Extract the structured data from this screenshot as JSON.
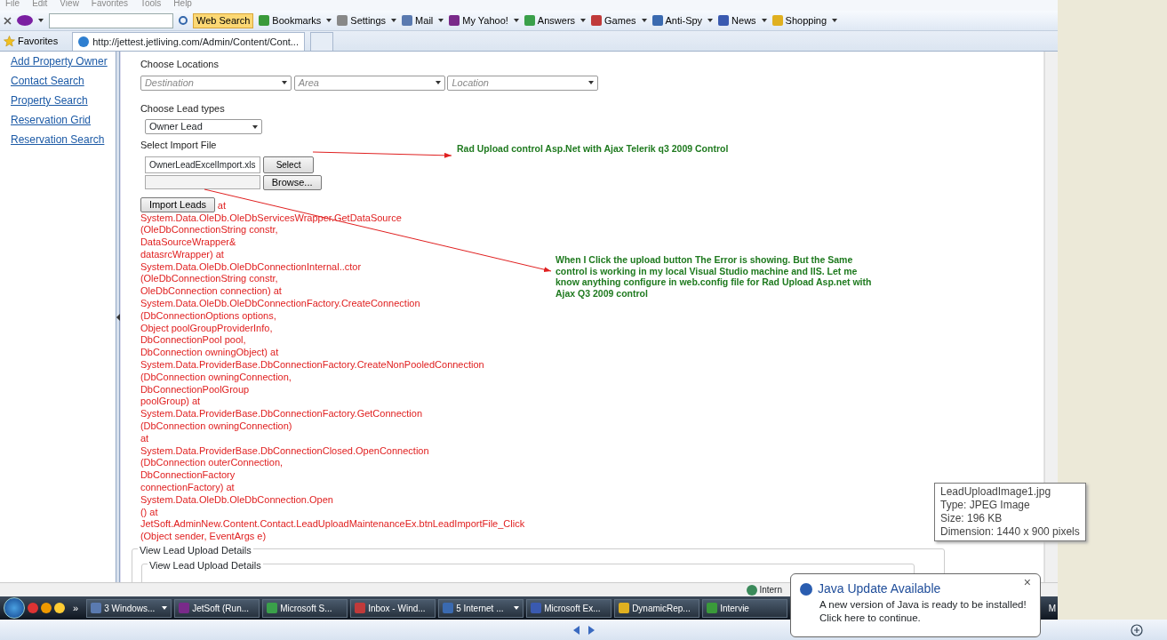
{
  "menu_bar": [
    "File",
    "Edit",
    "View",
    "Favorites",
    "Tools",
    "Help"
  ],
  "toolbar": {
    "search_button": "Web Search",
    "items": [
      "Bookmarks",
      "Settings",
      "Mail",
      "My Yahoo!",
      "Answers",
      "Games",
      "Anti-Spy",
      "News",
      "Shopping"
    ]
  },
  "tab_bar": {
    "favorites": "Favorites",
    "tabs": [
      {
        "title": "http://jettest.jetliving.com/Admin/Content/Cont...",
        "selected": true
      }
    ]
  },
  "sidebar": {
    "links": [
      "Add Property Owner",
      "Contact Search",
      "Property Search",
      "Reservation Grid",
      "Reservation Search"
    ]
  },
  "form": {
    "locations_label": "Choose Locations",
    "location_dropdowns": [
      {
        "placeholder": "Destination"
      },
      {
        "placeholder": "Area"
      },
      {
        "placeholder": "Location"
      }
    ],
    "lead_types_label": "Choose Lead types",
    "lead_type": "Owner Lead",
    "import_label": "Select Import File",
    "file_name": "OwnerLeadExcelImport.xls",
    "select_button": "Select",
    "browse_button": "Browse...",
    "import_button": "Import Leads",
    "error_first": "at",
    "error_lines": [
      "System.Data.OleDb.OleDbServicesWrapper.GetDataSource",
      "(OleDbConnectionString constr,",
      "DataSourceWrapper&",
      "datasrcWrapper) at",
      "System.Data.OleDb.OleDbConnectionInternal..ctor",
      "(OleDbConnectionString constr,",
      "OleDbConnection connection) at",
      "System.Data.OleDb.OleDbConnectionFactory.CreateConnection",
      "(DbConnectionOptions options,",
      "Object poolGroupProviderInfo,",
      "DbConnectionPool pool,",
      "DbConnection owningObject) at",
      "System.Data.ProviderBase.DbConnectionFactory.CreateNonPooledConnection",
      "(DbConnection owningConnection,",
      "DbConnectionPoolGroup",
      "poolGroup) at",
      "System.Data.ProviderBase.DbConnectionFactory.GetConnection",
      "(DbConnection owningConnection)",
      "at",
      "System.Data.ProviderBase.DbConnectionClosed.OpenConnection",
      "(DbConnection outerConnection,",
      "DbConnectionFactory",
      "connectionFactory) at",
      "System.Data.OleDb.OleDbConnection.Open",
      "() at",
      "JetSoft.AdminNew.Content.Contact.LeadUploadMaintenanceEx.btnLeadImportFile_Click",
      "(Object sender, EventArgs e)"
    ],
    "details_legend": "View Lead Upload Details",
    "details_inner_legend": "View Lead Upload Details"
  },
  "annotations": [
    "Rad Upload control Asp.Net with Ajax Telerik q3 2009 Control",
    "When I Click the upload button The Error is showing. But the Same control is working in my local Visual Studio machine and IIS.  Let me know anything configure in web.config file for Rad Upload Asp.net with Ajax Q3 2009 control"
  ],
  "status_bar": {
    "zone": "Intern"
  },
  "taskbar": {
    "buttons": [
      {
        "label": "3 Windows...",
        "dropdown": true
      },
      {
        "label": "JetSoft (Run...",
        "dropdown": false
      },
      {
        "label": "Microsoft S...",
        "dropdown": false
      },
      {
        "label": "Inbox - Wind...",
        "dropdown": false
      },
      {
        "label": "5 Internet ...",
        "dropdown": true
      },
      {
        "label": "Microsoft Ex...",
        "dropdown": false
      },
      {
        "label": "DynamicRep...",
        "dropdown": false
      },
      {
        "label": "Intervie",
        "dropdown": false
      }
    ],
    "overflow": "»",
    "clock": "M"
  },
  "tooltip": [
    "LeadUploadImage1.jpg",
    "Type: JPEG Image",
    "Size: 196 KB",
    "Dimension: 1440 x 900 pixels"
  ],
  "balloon": {
    "title": "Java Update Available",
    "lines": [
      "A new version of Java is ready to be installed!",
      "Click here to continue."
    ],
    "close": "×"
  }
}
